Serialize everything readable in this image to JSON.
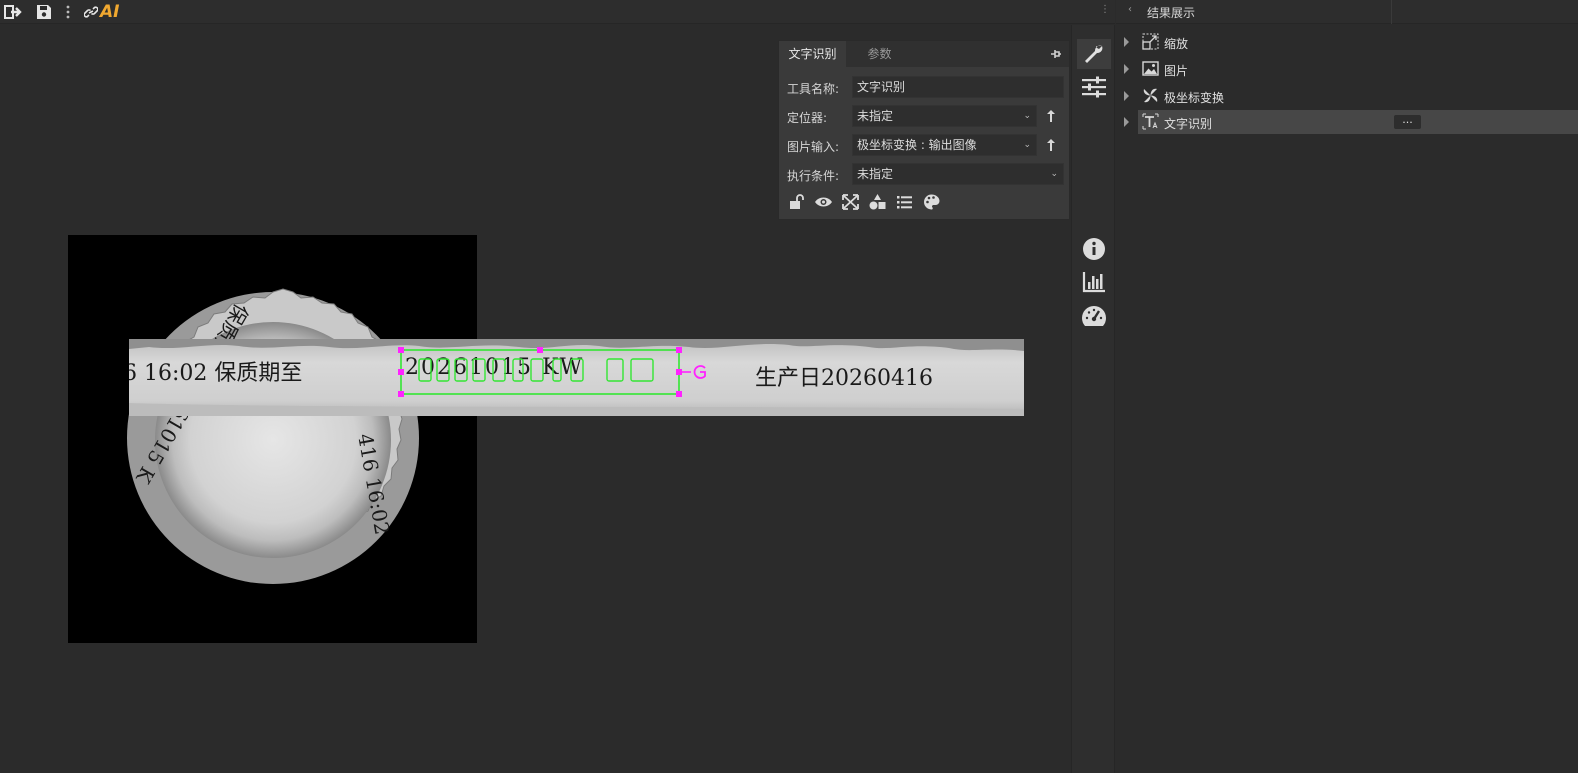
{
  "toolbar": {
    "ai_label": "AI",
    "icons": [
      "logout-icon",
      "save-icon",
      "more-vertical-icon",
      "link-icon"
    ]
  },
  "strip_text": {
    "left": "6  16:02   保质期至",
    "selected": "20261015 KW",
    "right": "生产日20260416"
  },
  "tool_panel": {
    "tabs": [
      {
        "label": "文字识别",
        "active": true
      },
      {
        "label": "参数",
        "active": false
      }
    ],
    "fields": {
      "tool_name": {
        "label": "工具名称:",
        "value": "文字识别"
      },
      "locator": {
        "label": "定位器:",
        "value": "未指定"
      },
      "image_input": {
        "label": "图片输入:",
        "value": "极坐标变换 : 输出图像"
      },
      "exec_cond": {
        "label": "执行条件:",
        "value": "未指定"
      }
    },
    "action_icons": [
      "unlock-icon",
      "eye-icon",
      "expand-icon",
      "shapes-icon",
      "list-icon",
      "palette-icon"
    ]
  },
  "vbar": {
    "icons": [
      "wrench-icon",
      "sliders-icon",
      "info-icon",
      "bar-chart-icon",
      "speedometer-icon"
    ]
  },
  "results": {
    "title": "结果展示",
    "items": [
      {
        "label": "缩放",
        "icon": "scale-icon",
        "selected": false
      },
      {
        "label": "图片",
        "icon": "image-icon",
        "selected": false
      },
      {
        "label": "极坐标变换",
        "icon": "polar-icon",
        "selected": false
      },
      {
        "label": "文字识别",
        "icon": "text-recognition-icon",
        "selected": true
      }
    ],
    "more_label": "..."
  },
  "colors": {
    "accent": "#f0a830",
    "roi_green": "#33e633",
    "roi_handle": "#ff22ff",
    "background": "#2b2b2b"
  }
}
